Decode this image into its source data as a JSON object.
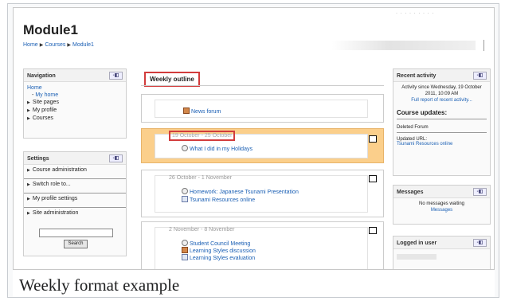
{
  "page": {
    "title": "Module1",
    "breadcrumb": [
      "Home",
      "Courses",
      "Module1"
    ],
    "caption": "Weekly format example"
  },
  "navigation": {
    "title": "Navigation",
    "items": [
      "Home",
      "My home",
      "Site pages",
      "My profile",
      "Courses"
    ]
  },
  "settings": {
    "title": "Settings",
    "items": [
      "Course administration",
      "Switch role to...",
      "My profile settings",
      "Site administration"
    ],
    "search_button": "Search"
  },
  "weekly_outline": {
    "heading": "Weekly outline",
    "section0_items": [
      "News forum"
    ],
    "sections": [
      {
        "date": "19 October - 25 October",
        "items": [
          "What I did in my Holidays"
        ]
      },
      {
        "date": "26 October - 1 November",
        "items": [
          "Homework: Japanese Tsunami Presentation",
          "Tsunami Resources online"
        ]
      },
      {
        "date": "2 November - 8 November",
        "items": [
          "Student Council Meeting",
          "Learning Styles discussion",
          "Learning Styles evaluation"
        ]
      }
    ]
  },
  "recent_activity": {
    "title": "Recent activity",
    "since": "Activity since Wednesday, 19 October 2011, 10:09 AM",
    "full_report": "Full report of recent activity...",
    "updates_heading": "Course updates:",
    "deleted": "Deleted Forum",
    "updated_url_label": "Updated URL:",
    "updated_url_link": "Tsunami Resources online"
  },
  "messages": {
    "title": "Messages",
    "none": "No messages waiting",
    "link": "Messages"
  },
  "logged_in": {
    "title": "Logged in user"
  },
  "colors": {
    "current_week": "#fbcf8b",
    "highlight_box": "#d23c3c",
    "link": "#1a5fb4"
  }
}
